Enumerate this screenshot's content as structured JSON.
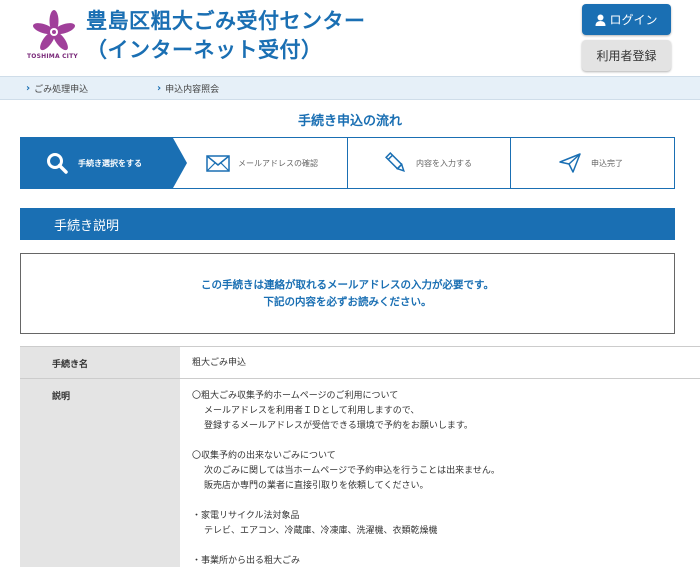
{
  "header": {
    "logo_text": "TOSHIMA CITY",
    "title_line1": "豊島区粗大ごみ受付センター",
    "title_line2": "（インターネット受付）",
    "login_label": "ログイン",
    "register_label": "利用者登録"
  },
  "subnav": {
    "items": [
      {
        "label": "ごみ処理申込"
      },
      {
        "label": "申込内容照会"
      }
    ]
  },
  "flow": {
    "title": "手続き申込の流れ",
    "steps": [
      {
        "label": "手続き選択をする",
        "icon": "search-icon",
        "active": true
      },
      {
        "label": "メールアドレスの確認",
        "icon": "envelope-icon",
        "active": false
      },
      {
        "label": "内容を入力する",
        "icon": "pencil-icon",
        "active": false
      },
      {
        "label": "申込完了",
        "icon": "paper-plane-icon",
        "active": false
      }
    ]
  },
  "section": {
    "title": "手続き説明"
  },
  "notice": {
    "line1": "この手続きは連絡が取れるメールアドレスの入力が必要です。",
    "line2": "下記の内容を必ずお読みください。"
  },
  "table": {
    "name_label": "手続き名",
    "name_value": "粗大ごみ申込",
    "desc_label": "説明",
    "desc_blocks": [
      [
        "〇粗大ごみ収集予約ホームページのご利用について",
        "メールアドレスを利用者ＩＤとして利用しますので、",
        "登録するメールアドレスが受信できる環境で予約をお願いします。"
      ],
      [
        "〇収集予約の出来ないごみについて",
        "次のごみに関しては当ホームページで予約申込を行うことは出来ません。",
        "販売店か専門の業者に直接引取りを依頼してください。"
      ],
      [
        "・家電リサイクル法対象品",
        "テレビ、エアコン、冷蔵庫、冷凍庫、洗濯機、衣類乾燥機"
      ],
      [
        "・事業所から出る粗大ごみ"
      ]
    ]
  },
  "colors": {
    "primary": "#1a6fb3",
    "subnav_bg": "#e6f0f8",
    "table_header_bg": "#e4e4e4"
  }
}
